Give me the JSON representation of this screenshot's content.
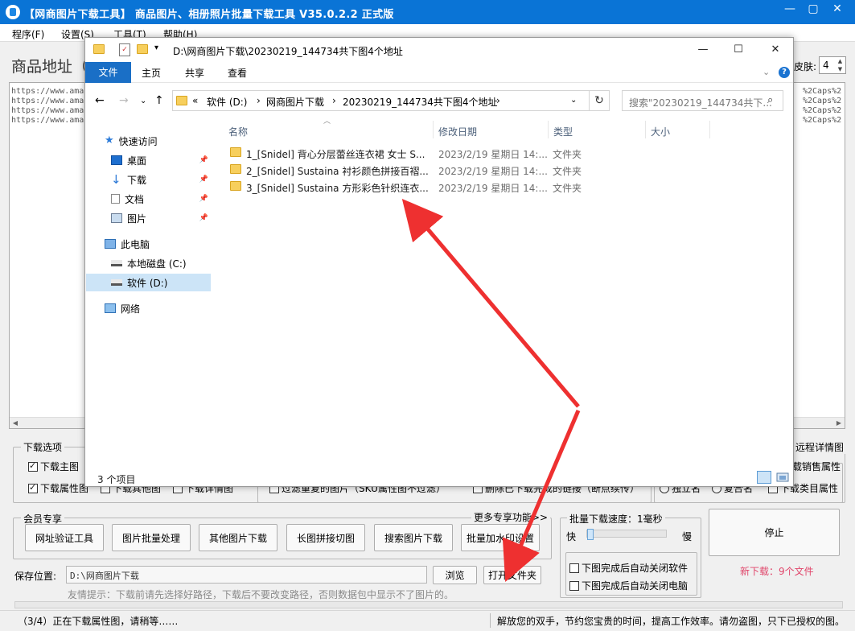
{
  "app": {
    "title": "【网商图片下载工具】 商品图片、相册照片批量下载工具 V35.0.2.2 正式版",
    "menu": [
      "程序(F)",
      "设置(S)",
      "工具(T)",
      "帮助(H)"
    ],
    "url_label": "商品地址（",
    "url_lines": [
      "https://www.ama",
      "https://www.ama",
      "https://www.ama",
      "https://www.ama"
    ],
    "url_tails": [
      "%2Caps%2",
      "%2Caps%2",
      "%2Caps%2",
      "%2Caps%2"
    ],
    "skin_label": "皮肤:",
    "skin_value": "4",
    "download_options": {
      "title": "下载选项",
      "items": [
        {
          "label": "下载主图",
          "checked": true
        },
        {
          "label": "下载属性图",
          "checked": true
        },
        {
          "label": "下载其他图",
          "checked": false
        },
        {
          "label": "下载详情图",
          "checked": false
        }
      ],
      "filter_items": [
        {
          "label": "过滤重复的图片（SKU属性图不过滤）",
          "checked": false
        },
        {
          "label": "删除已下载完成的链接（断点续传）",
          "checked": false
        }
      ],
      "right_title": "远程详情图",
      "right_items": [
        {
          "label": "载销售属性",
          "checked": false
        },
        {
          "label": "下载类目属性",
          "checked": false
        }
      ],
      "radios": [
        "独立名",
        "复合名"
      ]
    },
    "vip": {
      "title": "会员专享",
      "more": "更多专享功能>>",
      "buttons": [
        "网址验证工具",
        "图片批量处理",
        "其他图片下载",
        "长图拼接切图",
        "搜索图片下载",
        "批量加水印设置"
      ]
    },
    "speed": {
      "title": "批量下载速度：1毫秒",
      "fast": "快",
      "slow": "慢",
      "value_fraction": 0.0,
      "close_app_label": "下图完成后自动关闭软件",
      "shutdown_label": "下图完成后自动关闭电脑"
    },
    "stop_label": "停止",
    "new_download": "新下载：9个文件",
    "save": {
      "label": "保存位置:",
      "value": "D:\\网商图片下载",
      "browse": "浏览",
      "open_folder": "打开文件夹"
    },
    "tip": "友情提示：下载前请先选择好路径，下载后不要改变路径，否则数据包中显示不了图片的。",
    "status_left": "（3/4）正在下载属性图，请稍等……",
    "status_right": "解放您的双手，节约您宝贵的时间，提高工作效率。请勿盗图，只下已授权的图。"
  },
  "explorer": {
    "title": "D:\\网商图片下载\\20230219_144734共下图4个地址",
    "ribbon_tabs": [
      "文件",
      "主页",
      "共享",
      "查看"
    ],
    "breadcrumb": [
      "«",
      "软件 (D:)",
      "›",
      "网商图片下载",
      "›",
      "20230219_144734共下图4个地址",
      "›"
    ],
    "search_placeholder": "搜索\"20230219_144734共下...",
    "nav": {
      "quick_access": "快速访问",
      "desktop": "桌面",
      "downloads": "下载",
      "documents": "文档",
      "pictures": "图片",
      "this_pc": "此电脑",
      "local_disk": "本地磁盘 (C:)",
      "software_disk": "软件 (D:)",
      "network": "网络"
    },
    "columns": [
      "名称",
      "修改日期",
      "类型",
      "大小"
    ],
    "files": [
      {
        "name": "1_[Snidel] 背心分层蕾丝连衣裙 女士 S...",
        "date": "2023/2/19 星期日 14:...",
        "type": "文件夹"
      },
      {
        "name": "2_[Snidel] Sustaina 衬衫颜色拼接百褶...",
        "date": "2023/2/19 星期日 14:...",
        "type": "文件夹"
      },
      {
        "name": "3_[Snidel] Sustaina 方形彩色针织连衣...",
        "date": "2023/2/19 星期日 14:...",
        "type": "文件夹"
      }
    ],
    "item_count": "3 个项目"
  },
  "colors": {
    "title_bar": "#0a74d6",
    "accent": "#1a6fc6",
    "annotation_arrow": "#ee3030",
    "new_download_text": "#e0456a"
  }
}
